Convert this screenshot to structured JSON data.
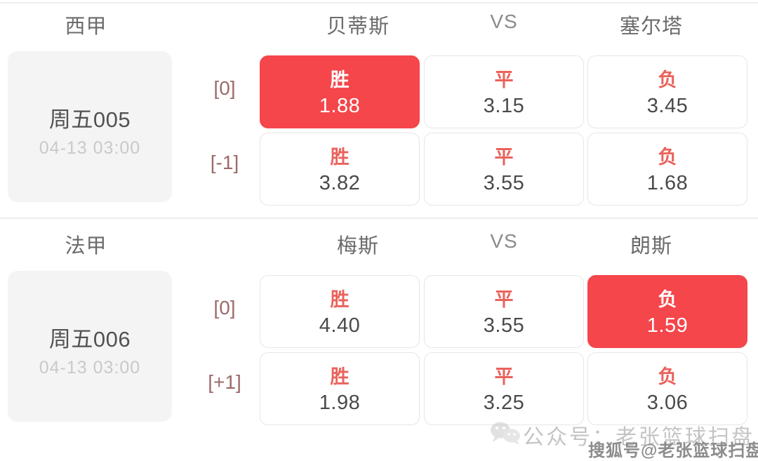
{
  "page": {
    "accent_red": "#f4464b",
    "label_red": "#e9635c",
    "handicap_color": "#9c6a6a",
    "card_bg": "#f4f4f5",
    "vs_label": "VS"
  },
  "matches": [
    {
      "league": "西甲",
      "home_team": "贝蒂斯",
      "vs": "VS",
      "away_team": "塞尔塔",
      "match_no": "周五005",
      "kickoff": "04-13 03:00",
      "rows": [
        {
          "handicap": "[0]",
          "cells": [
            {
              "label": "胜",
              "odds": "1.88",
              "selected": true
            },
            {
              "label": "平",
              "odds": "3.15",
              "selected": false
            },
            {
              "label": "负",
              "odds": "3.45",
              "selected": false
            }
          ]
        },
        {
          "handicap": "[-1]",
          "cells": [
            {
              "label": "胜",
              "odds": "3.82",
              "selected": false
            },
            {
              "label": "平",
              "odds": "3.55",
              "selected": false
            },
            {
              "label": "负",
              "odds": "1.68",
              "selected": false
            }
          ]
        }
      ]
    },
    {
      "league": "法甲",
      "home_team": "梅斯",
      "vs": "VS",
      "away_team": "朗斯",
      "match_no": "周五006",
      "kickoff": "04-13 03:00",
      "rows": [
        {
          "handicap": "[0]",
          "cells": [
            {
              "label": "胜",
              "odds": "4.40",
              "selected": false
            },
            {
              "label": "平",
              "odds": "3.55",
              "selected": false
            },
            {
              "label": "负",
              "odds": "1.59",
              "selected": true
            }
          ]
        },
        {
          "handicap": "[+1]",
          "cells": [
            {
              "label": "胜",
              "odds": "1.98",
              "selected": false
            },
            {
              "label": "平",
              "odds": "3.25",
              "selected": false
            },
            {
              "label": "负",
              "odds": "3.06",
              "selected": false
            }
          ]
        }
      ]
    }
  ],
  "watermark": {
    "wechat_line": "公众号：老张篮球扫盘",
    "sohu_line": "搜狐号@老张篮球扫盘"
  }
}
